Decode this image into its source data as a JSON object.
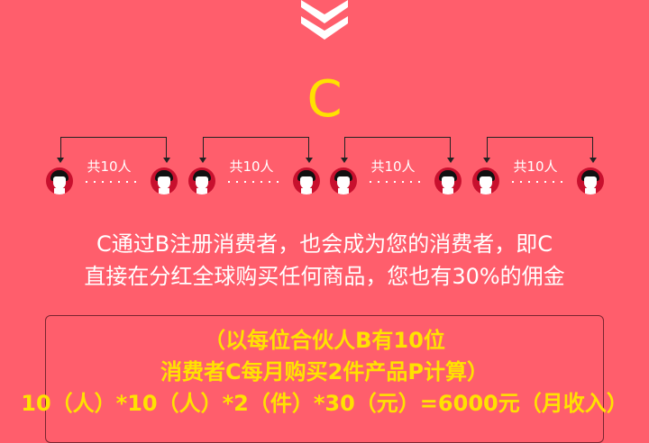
{
  "arrow_icon": "double-chevron-down-icon",
  "node_label": "C",
  "groups": [
    {
      "count_label": "共10人"
    },
    {
      "count_label": "共10人"
    },
    {
      "count_label": "共10人"
    },
    {
      "count_label": "共10人"
    }
  ],
  "description": {
    "line1": "C通过B注册消费者，也会成为您的消费者，即C",
    "line2": "直接在分红全球购买任何商品，您也有30%的佣金"
  },
  "formula": {
    "line1": "（以每位合伙人B有10位",
    "line2": "消费者C每月购买2件产品P计算）",
    "line3": "10（人）*10（人）*2（件）*30（元）=6000元（月收入）"
  },
  "colors": {
    "background": "#FF5E6C",
    "highlight": "#FFE200",
    "avatar": "#C8102E"
  }
}
